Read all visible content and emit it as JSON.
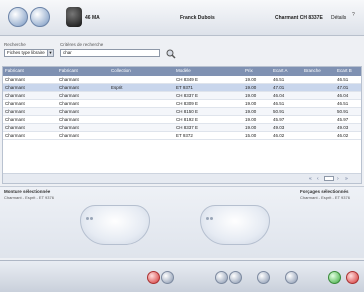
{
  "header": {
    "user_icon_text": "46 MA",
    "client": "Franck Dubois",
    "selection": "Charmant CH 8337E",
    "details": "Détails",
    "help_icon": "?"
  },
  "search": {
    "recherche_label": "Recherche",
    "mode_value": "Fiches type libraire",
    "criteria_label": "Critères de recherche",
    "query_value": "char"
  },
  "table": {
    "columns": [
      "Fabricant",
      "Fabricant",
      "Collection",
      "Modèle",
      "Prix",
      "Ecart A",
      "Branche",
      "Ecart B"
    ],
    "rows": [
      [
        "Charmant",
        "Charmant",
        "",
        "CH 8349 E",
        "19.00",
        "46.51",
        "",
        "46.51"
      ],
      [
        "Charmant",
        "Charmant",
        "Esprit",
        "ET 9371",
        "19.00",
        "47.01",
        "",
        "47.01"
      ],
      [
        "Charmant",
        "Charmant",
        "",
        "CH 8337 E",
        "19.00",
        "46.04",
        "",
        "46.04"
      ],
      [
        "Charmant",
        "Charmant",
        "",
        "CH 8309 E",
        "19.00",
        "46.51",
        "",
        "46.51"
      ],
      [
        "Charmant",
        "Charmant",
        "",
        "CH 8150 E",
        "19.00",
        "50.91",
        "",
        "50.91"
      ],
      [
        "Charmant",
        "Charmant",
        "",
        "CH 8192 E",
        "19.00",
        "45.97",
        "",
        "45.97"
      ],
      [
        "Charmant",
        "Charmant",
        "",
        "CH 8337 E",
        "19.00",
        "49.03",
        "",
        "49.03"
      ],
      [
        "Charmant",
        "Charmant",
        "",
        "ET 9372",
        "15.00",
        "46.02",
        "",
        "46.02"
      ]
    ],
    "pager": [
      "«",
      "‹",
      "›",
      "»"
    ]
  },
  "preview": {
    "left_title": "Monture sélectionnée",
    "left_sub": "Charmant - Esprit - ET 9376",
    "right_title": "Forçages sélectionnés",
    "right_sub": "Charmant - Esprit - ET 9376"
  }
}
